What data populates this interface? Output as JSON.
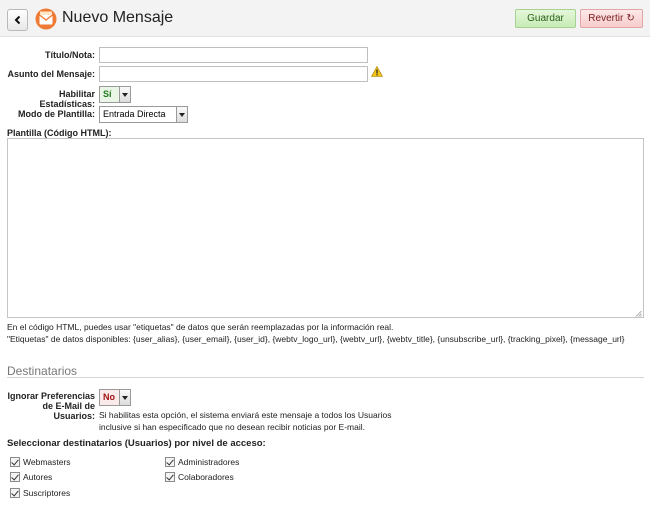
{
  "header": {
    "title": "Nuevo Mensaje",
    "save_label": "Guardar",
    "revert_label": "Revertir",
    "back_icon": "chevron-left-icon",
    "app_icon": "mail-envelope-icon"
  },
  "form": {
    "titulo_label": "Título/Nota:",
    "titulo_value": "",
    "asunto_label": "Asunto del Mensaje:",
    "asunto_value": "",
    "estadisticas_label": "Habilitar Estadísticas:",
    "estadisticas_value": "Sí",
    "modo_label": "Modo de Plantilla:",
    "modo_value": "Entrada Directa",
    "plantilla_label": "Plantilla (Código HTML):",
    "plantilla_value": "",
    "help_line1": "En el código HTML, puedes usar \"etiquetas\" de datos que serán reemplazadas por la información real.",
    "help_line2": "\"Etiquetas\" de datos disponibles: {user_alias}, {user_email}, {user_id}, {webtv_logo_url}, {webtv_url}, {webtv_title}, {unsubscribe_url}, {tracking_pixel}, {message_url}"
  },
  "recipients": {
    "section_title": "Destinatarios",
    "ignore_label_line1": "Ignorar Preferencias",
    "ignore_label_line2": "de E-Mail de Usuarios:",
    "ignore_value": "No",
    "ignore_help": "Si habilitas esta opción, el sistema enviará este mensaje a todos los Usuarios inclusive si han especificado que no desean recibir noticias por E-mail.",
    "access_title": "Seleccionar destinatarios (Usuarios) por nivel de acceso:",
    "levels": [
      {
        "label": "Webmasters",
        "checked": true
      },
      {
        "label": "Autores",
        "checked": true
      },
      {
        "label": "Suscriptores",
        "checked": true
      },
      {
        "label": "Administradores",
        "checked": true
      },
      {
        "label": "Colaboradores",
        "checked": true
      }
    ]
  },
  "colors": {
    "save_bg": "#d4f0c4",
    "revert_bg": "#f9d6d6",
    "accent_orange": "#e8712a"
  }
}
